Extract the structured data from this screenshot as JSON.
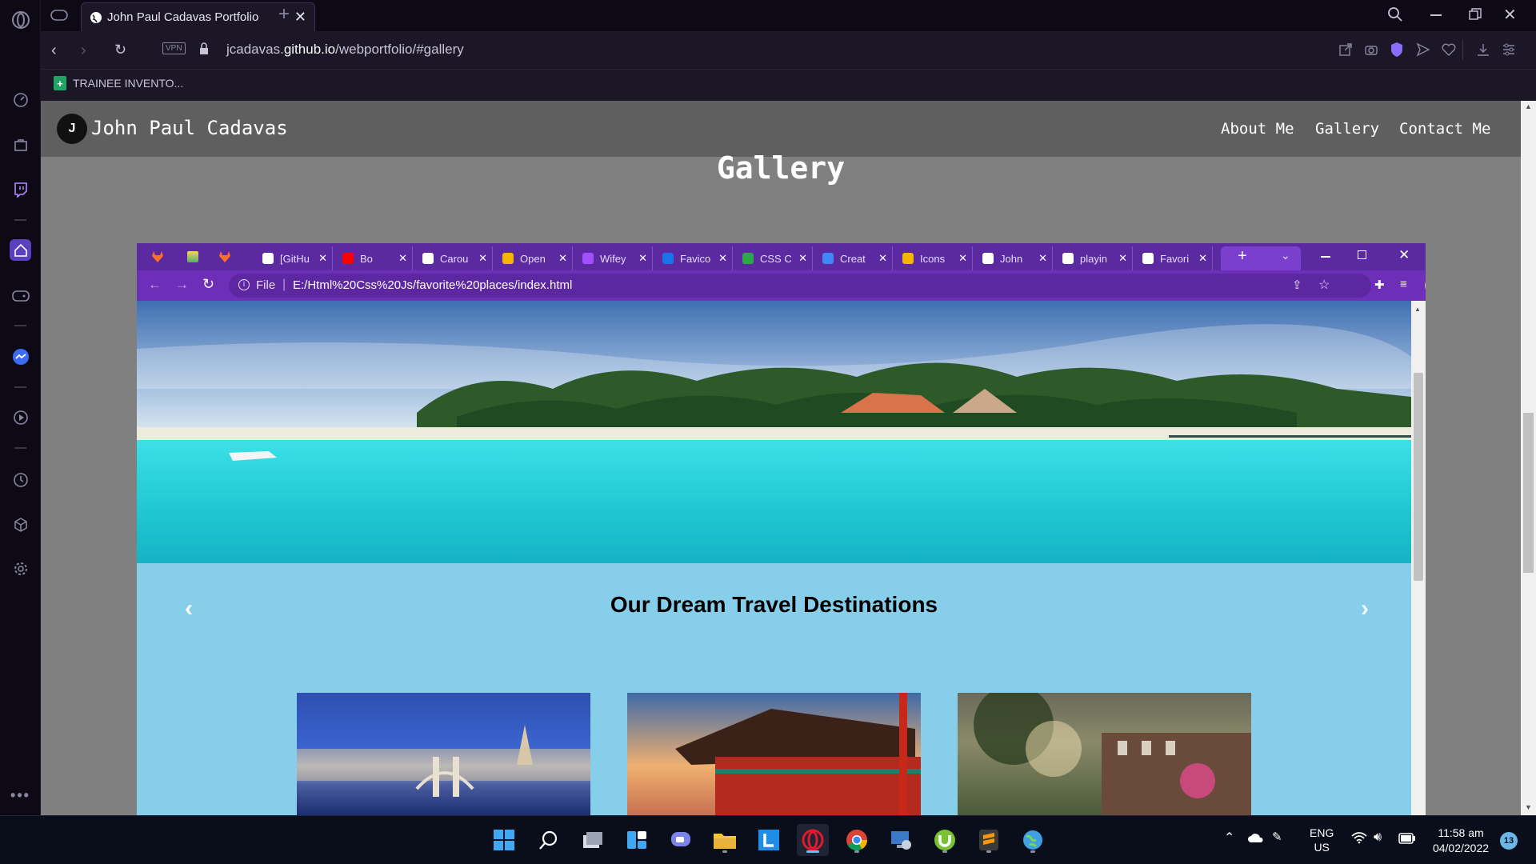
{
  "browser": {
    "tab_title": "John Paul Cadavas Portfolio",
    "url_host_prefix": "jcadavas.",
    "url_host_main": "github.io",
    "url_path": "/webportfolio/#gallery",
    "vpn_label": "VPN",
    "bookmark_label": "TRAINEE INVENTO..."
  },
  "site": {
    "brand": "John Paul Cadavas",
    "nav": [
      "About Me",
      "Gallery",
      "Contact Me"
    ],
    "section_title": "Gallery"
  },
  "inner_browser": {
    "tabs": [
      "[GitHu",
      "Bo",
      "Carou",
      "Open",
      "Wifey",
      "Favico",
      "CSS C",
      "Creat",
      "Icons",
      "John",
      "playin",
      "Favori"
    ],
    "file_label": "File",
    "url": "E:/Html%20Css%20Js/favorite%20places/index.html",
    "carousel_heading": "Our Dream Travel Destinations"
  },
  "taskbar": {
    "lang_top": "ENG",
    "lang_bottom": "US",
    "time": "11:58 am",
    "date": "04/02/2022",
    "notification_count": "13"
  },
  "colors": {
    "opera_bg": "#0d0a16",
    "page_bg": "#808080",
    "navbar_bg": "#5f5f5f",
    "inner_tabbar": "#5b2aa0",
    "carousel_bg": "#87ceeb"
  }
}
